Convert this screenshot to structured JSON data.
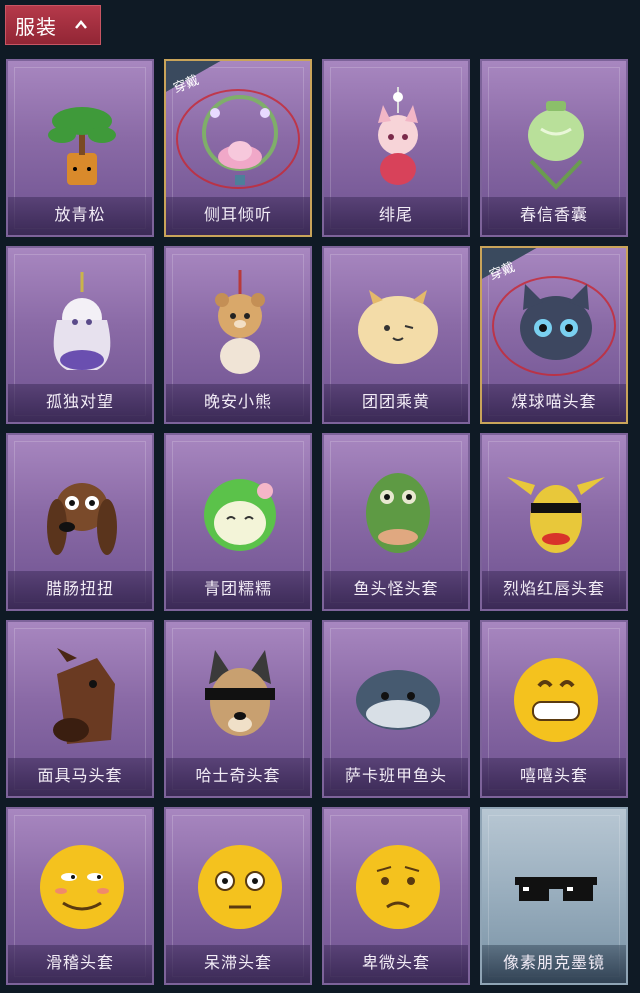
{
  "header": {
    "title": "服装"
  },
  "equipped_badge": "穿戴",
  "items": [
    {
      "name": "放青松",
      "icon": "bonsai-pine-icon",
      "theme": "purple",
      "equipped": false
    },
    {
      "name": "侧耳倾听",
      "icon": "lotus-wreath-icon",
      "theme": "purple",
      "equipped": true
    },
    {
      "name": "绯尾",
      "icon": "fox-girl-charm-icon",
      "theme": "purple",
      "equipped": false
    },
    {
      "name": "春信香囊",
      "icon": "sachet-pouch-icon",
      "theme": "purple",
      "equipped": false
    },
    {
      "name": "孤独对望",
      "icon": "white-hair-doll-charm-icon",
      "theme": "purple",
      "equipped": false
    },
    {
      "name": "晚安小熊",
      "icon": "teddy-bear-charm-icon",
      "theme": "purple",
      "equipped": false
    },
    {
      "name": "团团乘黄",
      "icon": "round-creature-icon",
      "theme": "purple",
      "equipped": false
    },
    {
      "name": "煤球喵头套",
      "icon": "black-cat-head-icon",
      "theme": "purple",
      "equipped": true
    },
    {
      "name": "腊肠扭扭",
      "icon": "dachshund-head-icon",
      "theme": "purple",
      "equipped": false
    },
    {
      "name": "青团糯糯",
      "icon": "green-dumpling-head-icon",
      "theme": "purple",
      "equipped": false
    },
    {
      "name": "鱼头怪头套",
      "icon": "fish-head-mask-icon",
      "theme": "purple",
      "equipped": false
    },
    {
      "name": "烈焰红唇头套",
      "icon": "yellow-mouse-mask-icon",
      "theme": "purple",
      "equipped": false
    },
    {
      "name": "面具马头套",
      "icon": "horse-head-mask-icon",
      "theme": "purple",
      "equipped": false
    },
    {
      "name": "哈士奇头套",
      "icon": "husky-head-icon",
      "theme": "purple",
      "equipped": false
    },
    {
      "name": "萨卡班甲鱼头",
      "icon": "fish-head-round-icon",
      "theme": "purple",
      "equipped": false
    },
    {
      "name": "嘻嘻头套",
      "icon": "grin-emoji-head-icon",
      "theme": "purple",
      "equipped": false
    },
    {
      "name": "滑稽头套",
      "icon": "smirk-emoji-head-icon",
      "theme": "purple",
      "equipped": false
    },
    {
      "name": "呆滞头套",
      "icon": "dazed-emoji-head-icon",
      "theme": "purple",
      "equipped": false
    },
    {
      "name": "卑微头套",
      "icon": "pleading-emoji-head-icon",
      "theme": "purple",
      "equipped": false
    },
    {
      "name": "像素朋克墨镜",
      "icon": "pixel-sunglasses-icon",
      "theme": "cyan",
      "equipped": false
    }
  ],
  "colors": {
    "background": "#0f1a25",
    "header": "#a22f3e",
    "card_purple": "#8a6aa6",
    "card_cyan": "#98adbd",
    "equipped_border": "#c9a45a",
    "badge": "#3a4a5e"
  }
}
